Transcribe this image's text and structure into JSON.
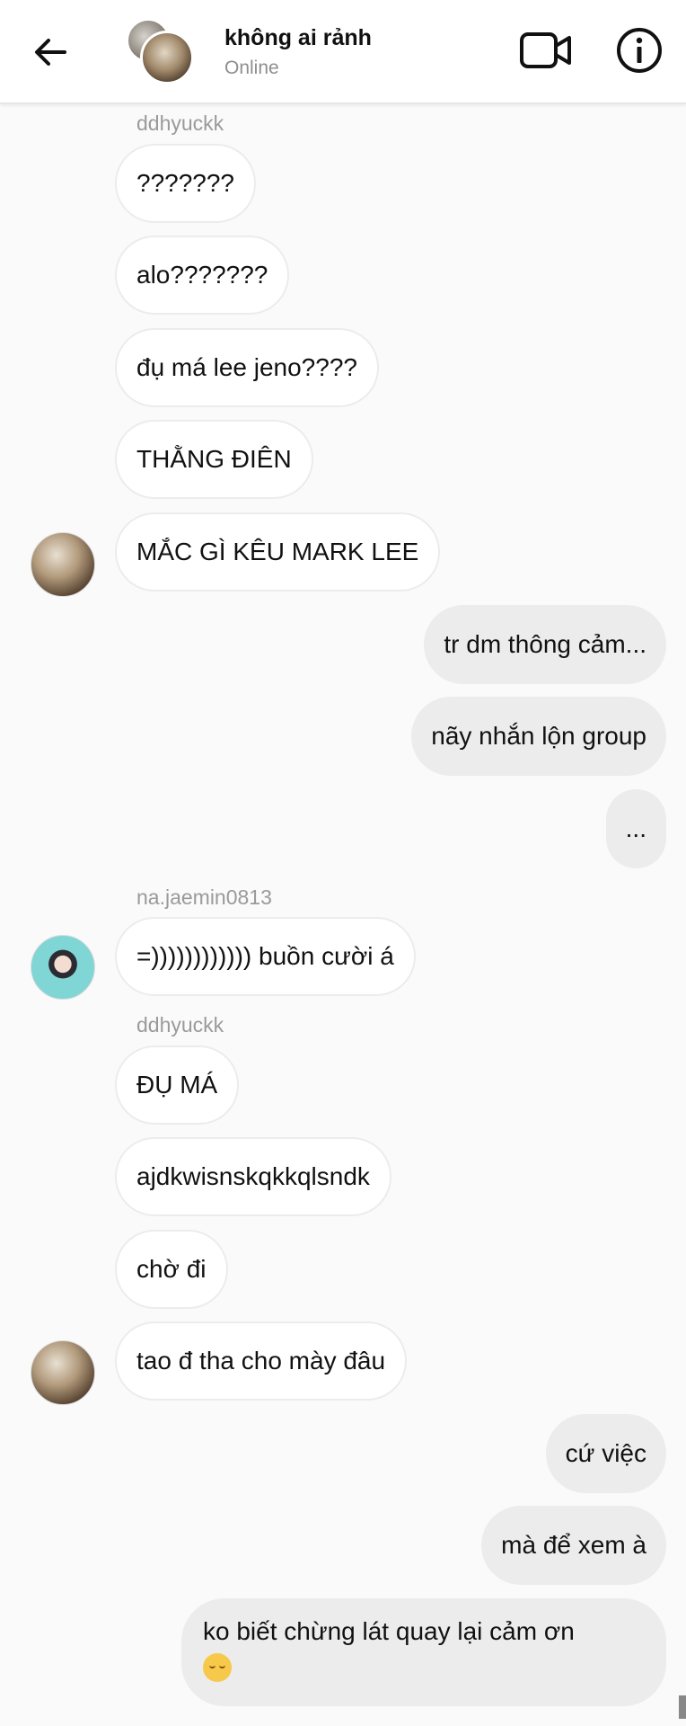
{
  "header": {
    "title": "không ai rảnh",
    "status": "Online"
  },
  "messages": {
    "sender_1": "ddhyuckk",
    "m1": "???????",
    "m2": "alo???????",
    "m3": "đụ má lee jeno????",
    "m4": "THẰNG ĐIÊN",
    "m5": "MẮC GÌ KÊU MARK LEE",
    "o1": "tr dm thông cảm...",
    "o2": "nãy nhắn lộn group",
    "o3": "...",
    "sender_2": "na.jaemin0813",
    "m6": "=)))))))))))) buồn cười á",
    "sender_3": "ddhyuckk",
    "m7": "ĐỤ MÁ",
    "m8": "ajdkwisnskqkkqlsndk",
    "m9": "chờ đi",
    "m10": "tao đ tha cho mày đâu",
    "o4": "cứ việc",
    "o5": "mà để xem à",
    "o6": "ko biết chừng lát quay lại cảm ơn",
    "o6_emoji": "relieved-face-emoji"
  },
  "colors": {
    "background": "#fafafa",
    "incoming_bubble": "#ffffff",
    "outgoing_bubble": "#ececec",
    "meta_text": "#9a9a9a"
  }
}
